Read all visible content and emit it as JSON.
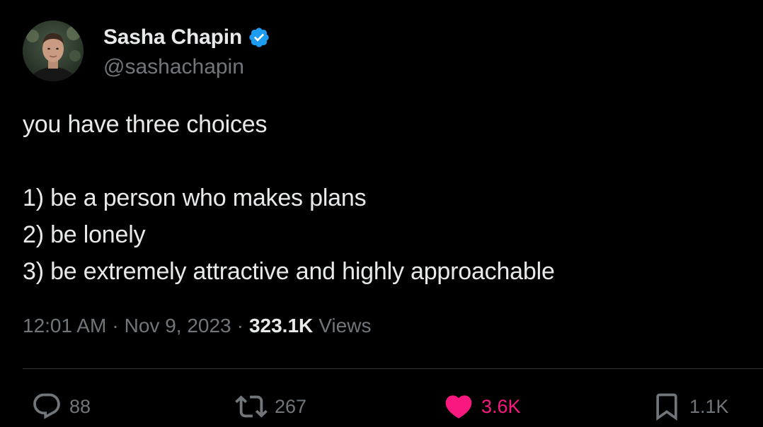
{
  "author": {
    "name": "Sasha Chapin",
    "handle": "@sashachapin",
    "verified_color": "#1d9bf0"
  },
  "tweet": {
    "lines": [
      "you have three choices",
      "",
      "1) be a person who makes plans",
      "2) be lonely",
      "3) be extremely attractive and highly approachable"
    ],
    "time": "12:01 AM",
    "separator": "·",
    "date": "Nov 9, 2023",
    "views_count": "323.1K",
    "views_label": "Views"
  },
  "actions": {
    "reply": {
      "count": "88",
      "icon": "reply-icon"
    },
    "retweet": {
      "count": "267",
      "icon": "retweet-icon"
    },
    "like": {
      "count": "3.6K",
      "icon": "heart-icon",
      "color": "#f91880",
      "liked": true
    },
    "bookmark": {
      "count": "1.1K",
      "icon": "bookmark-icon"
    }
  }
}
